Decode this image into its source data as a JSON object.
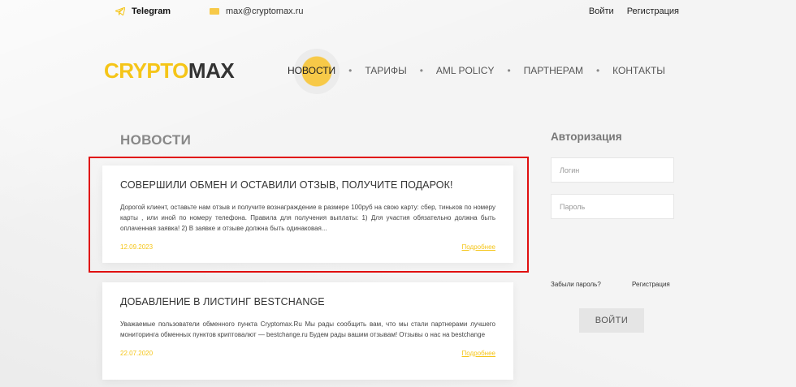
{
  "topbar": {
    "telegram_label": "Telegram",
    "email": "max@cryptomax.ru",
    "login_link": "Войти",
    "register_link": "Регистрация"
  },
  "logo": {
    "part1": "CRYPTO",
    "part2": "MAX"
  },
  "nav": {
    "items": [
      {
        "label": "НОВОСТИ",
        "active": true
      },
      {
        "label": "ТАРИФЫ"
      },
      {
        "label": "AML POLICY"
      },
      {
        "label": "ПАРТНЕРАМ"
      },
      {
        "label": "КОНТАКТЫ"
      }
    ],
    "separator": "•"
  },
  "news": {
    "title": "НОВОСТИ",
    "posts": [
      {
        "title": "СОВЕРШИЛИ ОБМЕН И ОСТАВИЛИ ОТЗЫВ, ПОЛУЧИТЕ ПОДАРОК!",
        "text": "Дорогой клиент, оставьте нам отзыв и получите вознаграждение в размере 100руб на свою карту: сбер, тиньков по номеру карты , или иной по номеру телефона. Правила для получения выплаты: 1) Для участия обязательно должна быть оплаченная заявка! 2) В заявке и отзыве должна быть одинаковая...",
        "date": "12.09.2023",
        "more": "Подробнее"
      },
      {
        "title": "ДОБАВЛЕНИЕ В ЛИСТИНГ BESTCHANGE",
        "text": "Уважаемые пользователи обменного пункта Cryptomax.Ru Мы рады сообщить вам, что мы стали партнерами лучшего мониторинга обменных пунктов криптовалют — bestchange.ru Будем рады вашим отзывам! Отзывы о нас на bestchange",
        "date": "22.07.2020",
        "more": "Подробнее"
      }
    ]
  },
  "auth": {
    "title": "Авторизация",
    "login_placeholder": "Логин",
    "password_placeholder": "Пароль",
    "forgot": "Забыли пароль?",
    "register": "Регистрация",
    "submit": "ВОЙТИ"
  },
  "colors": {
    "accent": "#f5c518",
    "highlight": "#e01010"
  }
}
